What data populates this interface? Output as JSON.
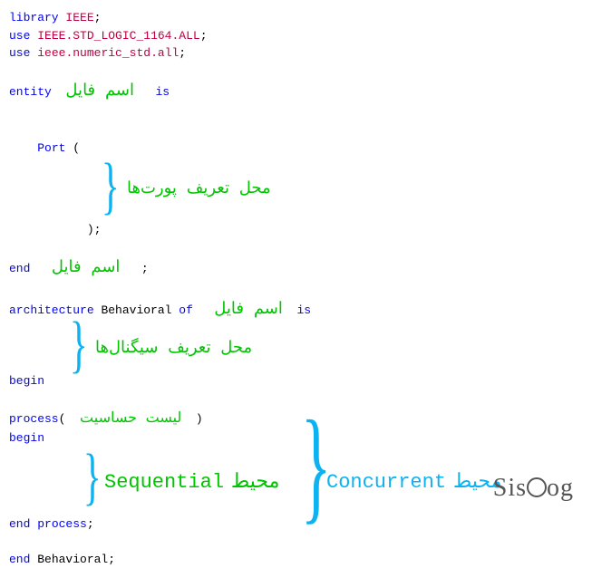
{
  "code": {
    "library_kw": "library",
    "ieee1": "IEEE",
    "semi": ";",
    "use_kw1": "use",
    "ieee_std": "IEEE",
    "dot": ".",
    "std_logic": "STD_LOGIC_1164",
    "all1": "ALL",
    "use_kw2": "use",
    "ieee2": "ieee",
    "numeric": "numeric_std",
    "all2": "all",
    "entity_kw": "entity",
    "is_kw": "is",
    "port_kw": "Port",
    "open_paren": "(",
    "close_paren": ")",
    "end_kw": "end",
    "architecture_kw": "architecture",
    "behavioral": "Behavioral",
    "of_kw": "of",
    "is_kw2": "is",
    "begin_kw": "begin",
    "process_kw": "process",
    "end_process": "end",
    "process_kw2": "process",
    "end_behavioral": "end",
    "behavioral2": "Behavioral"
  },
  "annot": {
    "file_name": "اسم فایل",
    "ports_def": "محل تعریف پورت‌ها",
    "signals_def": "محل تعریف سیگنال‌ها",
    "sensitivity_list": "لیست حساسیت",
    "sequential_env": "محیط",
    "sequential_label": "Sequential",
    "concurrent_env": "محیط",
    "concurrent_label": "Concurrent"
  },
  "watermark": {
    "part1": "Sis",
    "part2": "og"
  }
}
